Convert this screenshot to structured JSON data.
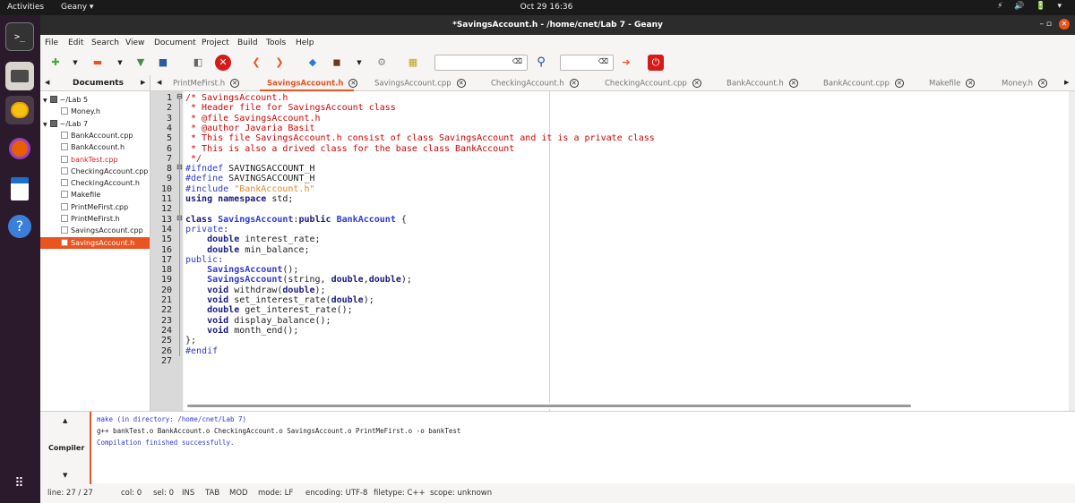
{
  "system": {
    "activities": "Activities",
    "app_menu": "Geany ▾",
    "clock": "Oct 29  16:36",
    "tray": "⚡ 🔊 🔋 ▾"
  },
  "window": {
    "title": "*SavingsAccount.h - /home/cnet/Lab 7 - Geany",
    "controls": "–   ▫",
    "close": "✕"
  },
  "menu": [
    "File",
    "Edit",
    "Search",
    "View",
    "Document",
    "Project",
    "Build",
    "Tools",
    "Help"
  ],
  "toolbar": {
    "search_value": "",
    "goto_value": "",
    "clear": "⌫"
  },
  "sidebar": {
    "header": "Documents",
    "tree": [
      {
        "label": "~/Lab 5",
        "indent": 0,
        "type": "folder"
      },
      {
        "label": "Money.h",
        "indent": 2,
        "type": "file"
      },
      {
        "label": "~/Lab 7",
        "indent": 0,
        "type": "folder"
      },
      {
        "label": "BankAccount.cpp",
        "indent": 2,
        "type": "file"
      },
      {
        "label": "BankAccount.h",
        "indent": 2,
        "type": "file"
      },
      {
        "label": "bankTest.cpp",
        "indent": 2,
        "type": "file",
        "state": "modified"
      },
      {
        "label": "CheckingAccount.cpp",
        "indent": 2,
        "type": "file"
      },
      {
        "label": "CheckingAccount.h",
        "indent": 2,
        "type": "file"
      },
      {
        "label": "Makefile",
        "indent": 2,
        "type": "file"
      },
      {
        "label": "PrintMeFirst.cpp",
        "indent": 2,
        "type": "file"
      },
      {
        "label": "PrintMeFirst.h",
        "indent": 2,
        "type": "file"
      },
      {
        "label": "SavingsAccount.cpp",
        "indent": 2,
        "type": "file"
      },
      {
        "label": "SavingsAccount.h",
        "indent": 2,
        "type": "file",
        "state": "selected"
      }
    ]
  },
  "tabs": [
    {
      "label": "PrintMeFirst.h",
      "active": false
    },
    {
      "label": "SavingsAccount.h",
      "active": true
    },
    {
      "label": "SavingsAccount.cpp",
      "active": false
    },
    {
      "label": "CheckingAccount.h",
      "active": false
    },
    {
      "label": "CheckingAccount.cpp",
      "active": false
    },
    {
      "label": "BankAccount.h",
      "active": false
    },
    {
      "label": "BankAccount.cpp",
      "active": false
    },
    {
      "label": "Makefile",
      "active": false
    },
    {
      "label": "Money.h",
      "active": false
    }
  ],
  "editor": {
    "lines": [
      [
        [
          "/* SavingsAccount.h",
          "c"
        ]
      ],
      [
        [
          " * Header file for SavingsAccount class",
          "c"
        ]
      ],
      [
        [
          " * @file SavingsAccount.h",
          "c"
        ]
      ],
      [
        [
          " * @author Javaria Basit",
          "c"
        ]
      ],
      [
        [
          " * This file SavingsAccount.h consist of class SavingsAccount and it is a private class",
          "c"
        ]
      ],
      [
        [
          " * This is also a drived class for the base class BankAccount",
          "c"
        ]
      ],
      [
        [
          " */",
          "c"
        ]
      ],
      [
        [
          "#ifndef ",
          "p"
        ],
        [
          "SAVINGSACCOUNT_H",
          "t"
        ]
      ],
      [
        [
          "#define ",
          "p"
        ],
        [
          "SAVINGSACCOUNT_H",
          "t"
        ]
      ],
      [
        [
          "#include ",
          "p"
        ],
        [
          "\"BankAccount.h\"",
          "s"
        ]
      ],
      [
        [
          "using namespace",
          "k"
        ],
        [
          " std;",
          "t"
        ]
      ],
      [
        [
          "",
          "t"
        ]
      ],
      [
        [
          "class ",
          "k"
        ],
        [
          "SavingsAccount",
          "cls"
        ],
        [
          ":",
          "t"
        ],
        [
          "public ",
          "k"
        ],
        [
          "BankAccount",
          "cls"
        ],
        [
          " {",
          "t"
        ]
      ],
      [
        [
          "private",
          "p"
        ],
        [
          ":",
          "t"
        ]
      ],
      [
        [
          "    ",
          "t"
        ],
        [
          "double",
          "k"
        ],
        [
          " interest_rate;",
          "t"
        ]
      ],
      [
        [
          "    ",
          "t"
        ],
        [
          "double",
          "k"
        ],
        [
          " min_balance;",
          "t"
        ]
      ],
      [
        [
          "public",
          "p"
        ],
        [
          ":",
          "t"
        ]
      ],
      [
        [
          "    ",
          "t"
        ],
        [
          "SavingsAccount",
          "cls"
        ],
        [
          "();",
          "t"
        ]
      ],
      [
        [
          "    ",
          "t"
        ],
        [
          "SavingsAccount",
          "cls"
        ],
        [
          "(string, ",
          "t"
        ],
        [
          "double",
          "k"
        ],
        [
          ",",
          "t"
        ],
        [
          "double",
          "k"
        ],
        [
          ");",
          "t"
        ]
      ],
      [
        [
          "    ",
          "t"
        ],
        [
          "void",
          "k"
        ],
        [
          " withdraw(",
          "t"
        ],
        [
          "double",
          "k"
        ],
        [
          ");",
          "t"
        ]
      ],
      [
        [
          "    ",
          "t"
        ],
        [
          "void",
          "k"
        ],
        [
          " set_interest_rate(",
          "t"
        ],
        [
          "double",
          "k"
        ],
        [
          ");",
          "t"
        ]
      ],
      [
        [
          "    ",
          "t"
        ],
        [
          "double",
          "k"
        ],
        [
          " get_interest_rate();",
          "t"
        ]
      ],
      [
        [
          "    ",
          "t"
        ],
        [
          "void",
          "k"
        ],
        [
          " display_balance();",
          "t"
        ]
      ],
      [
        [
          "    ",
          "t"
        ],
        [
          "void",
          "k"
        ],
        [
          " month_end();",
          "t"
        ]
      ],
      [
        [
          "};",
          "t"
        ]
      ],
      [
        [
          "#endif",
          "p"
        ]
      ],
      [
        [
          "",
          "t"
        ]
      ]
    ],
    "colors": {
      "c": "#d40000",
      "p": "#2e3ad6",
      "t": "#222222",
      "s": "#e28a2a",
      "k": "#1a1a80",
      "cls": "#2e3ad6"
    }
  },
  "messages": {
    "tab": "Compiler",
    "lines": [
      {
        "text": "make (in directory: /home/cnet/Lab 7)",
        "color": "#2e3ad6"
      },
      {
        "text": "g++ bankTest.o BankAccount.o CheckingAccount.o SavingsAccount.o PrintMeFirst.o -o bankTest",
        "color": "#222222"
      },
      {
        "text": "Compilation finished successfully.",
        "color": "#2e3ad6"
      }
    ]
  },
  "status": {
    "line": "line: 27 / 27",
    "col": "col: 0",
    "sel": "sel: 0",
    "ins": "INS",
    "tab": "TAB",
    "mod": "MOD",
    "mode": "mode: LF",
    "encoding": "encoding: UTF-8",
    "filetype": "filetype: C++",
    "scope": "scope: unknown"
  },
  "accent": "#e95420"
}
